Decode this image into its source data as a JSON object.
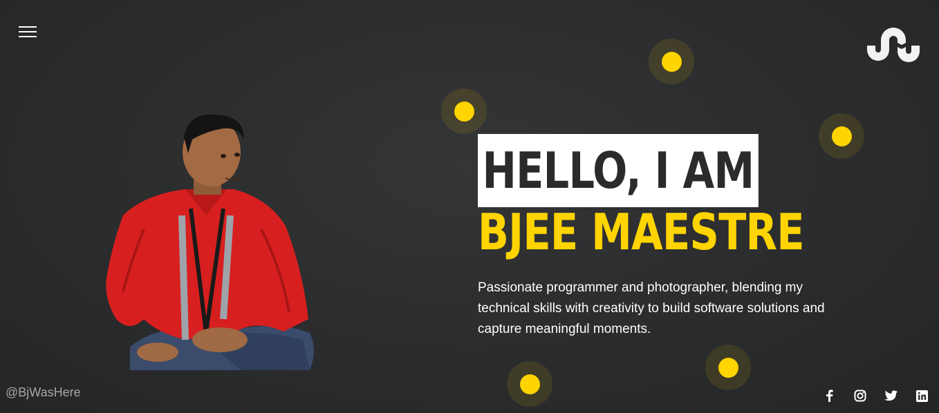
{
  "nav": {
    "menu_icon": "hamburger-menu-icon",
    "logo_icon": "stumbleupon-logo-icon"
  },
  "hero": {
    "greeting": "HELLO, I AM",
    "name": "BJEE MAESTRE",
    "tagline": "Passionate programmer and photographer, blending my technical skills with creativity to build software solutions and capture meaningful moments."
  },
  "footer": {
    "handle": "@BjWasHere",
    "socials": [
      {
        "icon": "facebook-icon"
      },
      {
        "icon": "instagram-icon"
      },
      {
        "icon": "twitter-icon"
      },
      {
        "icon": "linkedin-icon"
      }
    ]
  },
  "colors": {
    "accent": "#ffd400",
    "background": "#2b2c2d",
    "text": "#ffffff",
    "muted": "#a7a8a9"
  }
}
